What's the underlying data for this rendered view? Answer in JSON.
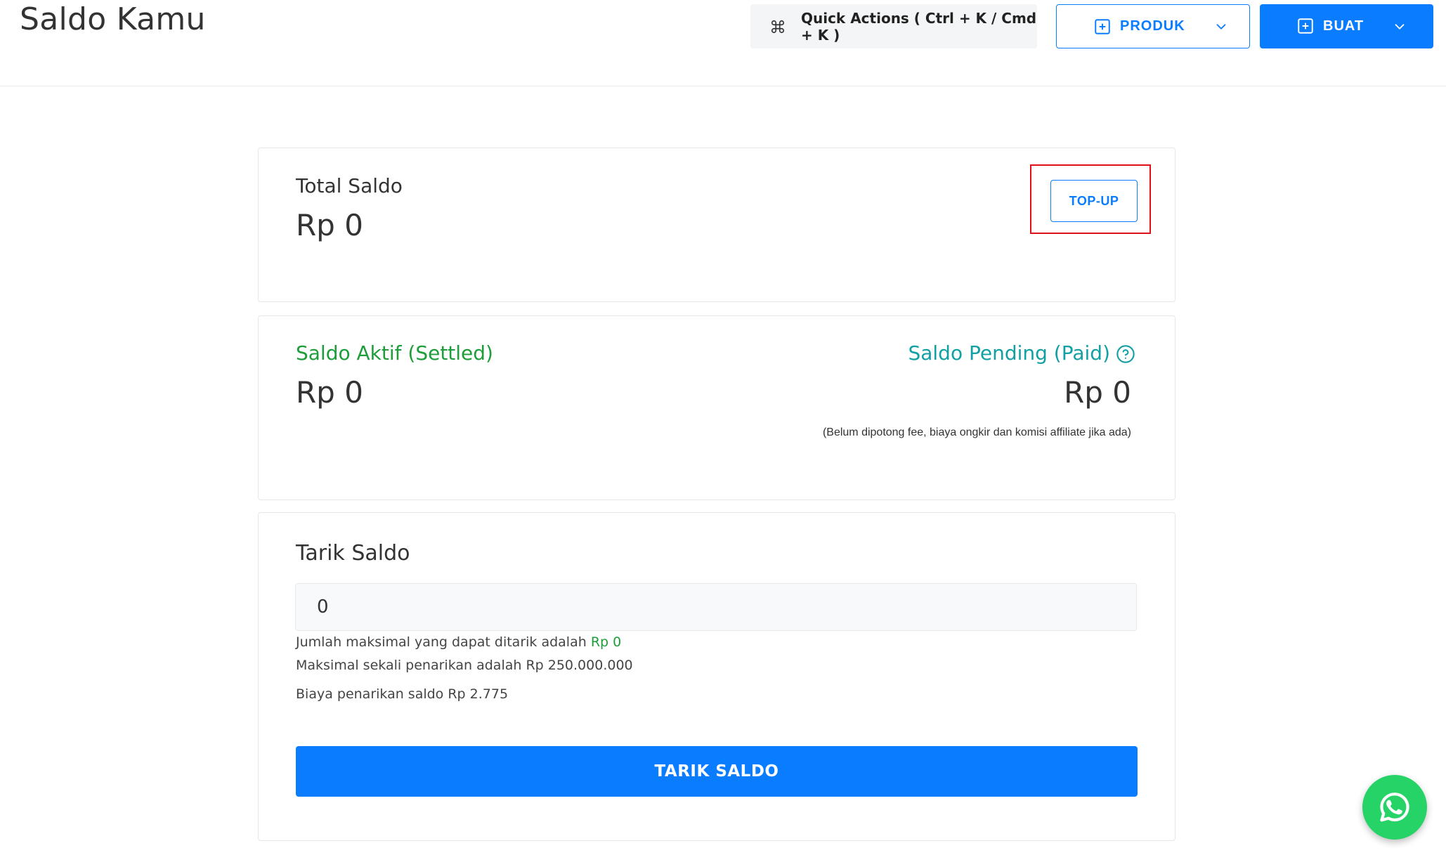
{
  "header": {
    "title": "Saldo Kamu",
    "quick_actions_label": "Quick Actions ( Ctrl + K / Cmd + K )",
    "produk_label": "PRODUK",
    "buat_label": "BUAT"
  },
  "total": {
    "label": "Total Saldo",
    "amount": "Rp 0",
    "topup_label": "TOP-UP"
  },
  "balances": {
    "active_label": "Saldo Aktif (Settled)",
    "active_amount": "Rp 0",
    "pending_label": "Saldo Pending (Paid)",
    "pending_amount": "Rp 0",
    "pending_note": "(Belum dipotong fee, biaya ongkir dan komisi affiliate jika ada)"
  },
  "withdraw": {
    "title": "Tarik Saldo",
    "input_value": "0",
    "max_text_prefix": "Jumlah maksimal yang dapat ditarik adalah ",
    "max_amount": "Rp 0",
    "max_once_text": "Maksimal sekali penarikan adalah Rp 250.000.000",
    "fee_text": "Biaya penarikan saldo Rp 2.775",
    "button_label": "TARIK SALDO"
  },
  "colors": {
    "primary": "#0a7cff",
    "active_green": "#1e9e3a",
    "pending_teal": "#13a0a4",
    "whatsapp": "#25d366",
    "highlight": "#e0101a"
  },
  "icons": {
    "quick_actions": "command-icon",
    "produk": "plus-square-icon",
    "buat": "plus-square-icon",
    "pending_help": "question-circle-icon",
    "floating": "whatsapp-icon"
  }
}
